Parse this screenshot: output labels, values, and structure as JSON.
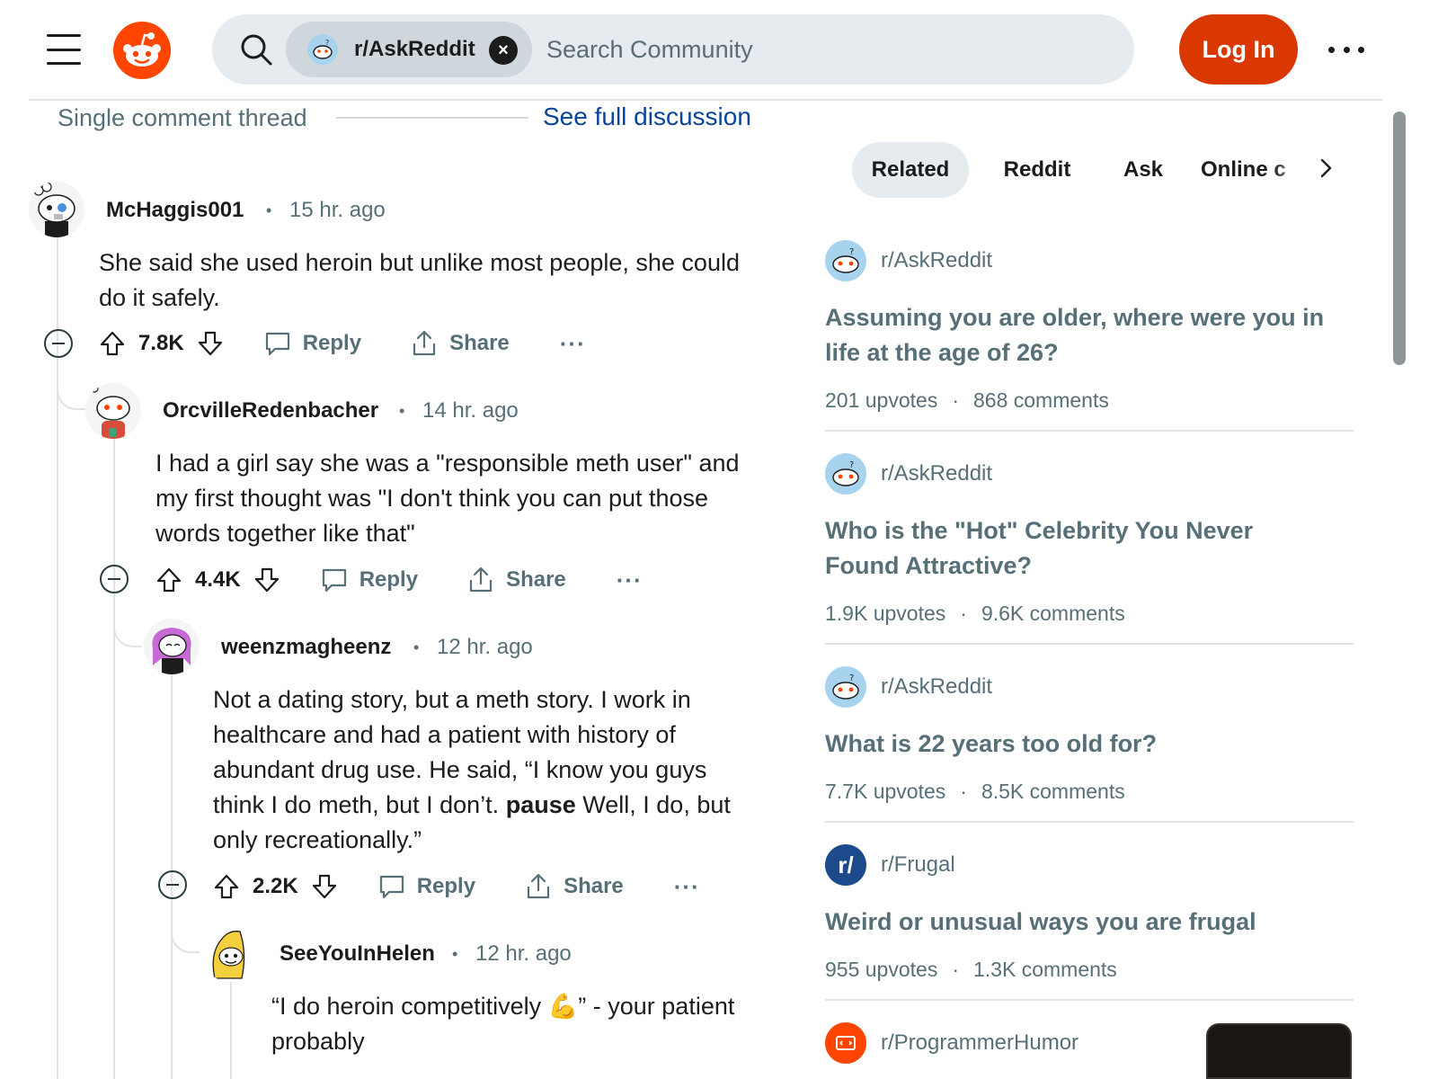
{
  "header": {
    "community_chip": "r/AskReddit",
    "search_placeholder": "Search Community",
    "login_label": "Log In"
  },
  "thread_bar": {
    "label": "Single comment thread",
    "link": "See full discussion"
  },
  "comments": [
    {
      "username": "McHaggis001",
      "time": "15 hr. ago",
      "body_lines": [
        "She said she used heroin but unlike most people, she could",
        "do it safely."
      ],
      "votes": "7.8K",
      "reply": "Reply",
      "share": "Share"
    },
    {
      "username": "OrcvilleRedenbacher",
      "time": "14 hr. ago",
      "body_lines": [
        "I had a girl say she was a \"responsible meth user\" and",
        "my first thought was \"I don't think you can put those",
        "words together like that\""
      ],
      "votes": "4.4K",
      "reply": "Reply",
      "share": "Share"
    },
    {
      "username": "weenzmagheenz",
      "time": "12 hr. ago",
      "body_lines": [
        "Not a dating story, but a meth story. I work in",
        "healthcare and had a patient with history of",
        "abundant drug use. He said, “I know you guys"
      ],
      "body_line4_pre": "think I do meth, but I don’t.",
      "body_line4_bold": "pause",
      "body_line4_post": "Well, I do, but",
      "body_line5": "only recreationally.”",
      "votes": "2.2K",
      "reply": "Reply",
      "share": "Share"
    },
    {
      "username": "SeeYouInHelen",
      "time": "12 hr. ago",
      "body_line1_pre": "“I do heroin competitively",
      "body_line1_emoji": "💪",
      "body_line1_post": "” - your patient",
      "body_line2": "probably"
    }
  ],
  "related": {
    "tabs": [
      "Related",
      "Reddit",
      "Ask",
      "Online c"
    ],
    "active_tab": "Related",
    "items": [
      {
        "subreddit": "r/AskReddit",
        "title_lines": [
          "Assuming you are older, where were you in",
          "life at the age of 26?"
        ],
        "upvotes": "201 upvotes",
        "comments": "868 comments"
      },
      {
        "subreddit": "r/AskReddit",
        "title_lines": [
          "Who is the \"Hot\" Celebrity You Never",
          "Found Attractive?"
        ],
        "upvotes": "1.9K upvotes",
        "comments": "9.6K comments"
      },
      {
        "subreddit": "r/AskReddit",
        "title_lines": [
          "What is 22 years too old for?"
        ],
        "upvotes": "7.7K upvotes",
        "comments": "8.5K comments"
      },
      {
        "subreddit": "r/Frugal",
        "title_lines": [
          "Weird or unusual ways you are frugal"
        ],
        "upvotes": "955 upvotes",
        "comments": "1.3K comments",
        "avatar_text": "r/"
      },
      {
        "subreddit": "r/ProgrammerHumor"
      }
    ],
    "stat_separator": "·"
  },
  "misc": {
    "dot": "•",
    "more": "···",
    "chip_close": "×"
  },
  "colors": {
    "brand": "#ff4500",
    "login": "#d93900",
    "link": "#0a449b",
    "muted": "#576f76"
  }
}
